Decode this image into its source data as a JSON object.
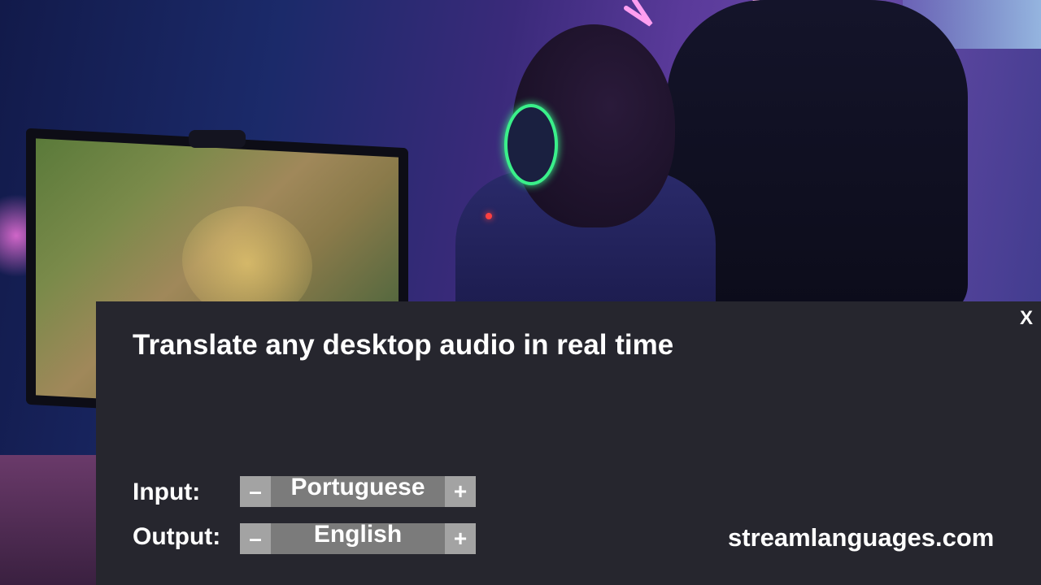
{
  "overlay": {
    "close_label": "X",
    "title": "Translate any desktop audio in real time",
    "input": {
      "label": "Input:",
      "minus": "–",
      "value": "Portuguese",
      "plus": "+"
    },
    "output": {
      "label": "Output:",
      "minus": "–",
      "value": "English",
      "plus": "+"
    },
    "website": "streamlanguages.com"
  },
  "colors": {
    "panel_bg": "#26262e",
    "stepper_bg": "#7b7b7b",
    "stepper_button_bg": "#a3a3a3",
    "text": "#ffffff",
    "headset_neon": "#3af08a"
  },
  "icons": {
    "close": "close-icon",
    "decrement": "minus-icon",
    "increment": "plus-icon"
  }
}
